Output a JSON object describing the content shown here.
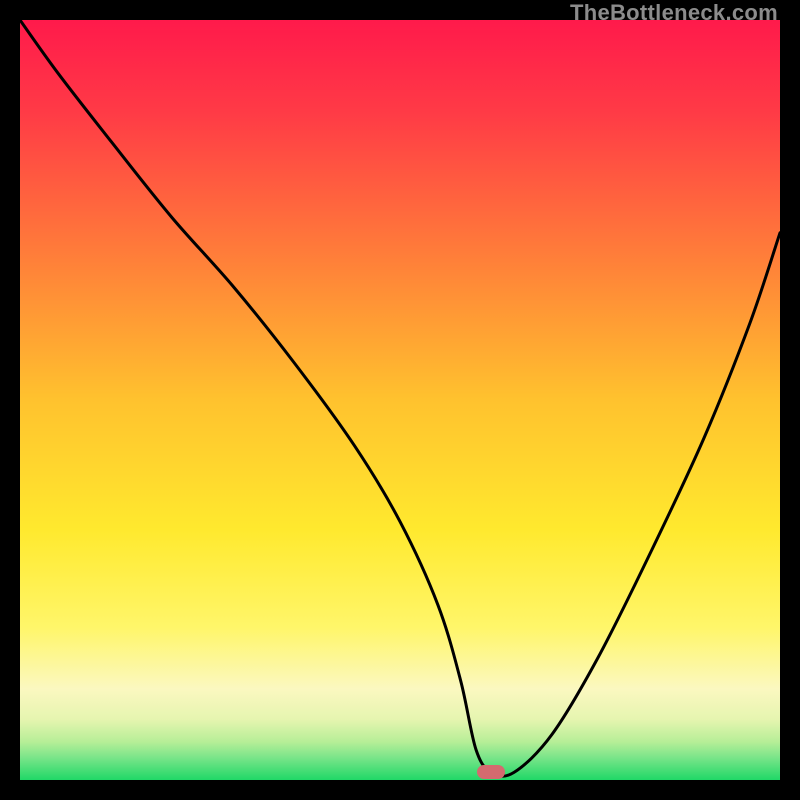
{
  "watermark": "TheBottleneck.com",
  "marker": {
    "color": "#d46a6f",
    "x_pct": 62,
    "y_pct": 99
  },
  "chart_data": {
    "type": "line",
    "title": "",
    "xlabel": "",
    "ylabel": "",
    "xlim": [
      0,
      100
    ],
    "ylim": [
      0,
      100
    ],
    "grid": false,
    "legend": false,
    "gradient_stops": [
      {
        "pct": 0,
        "color": "#ff1a4b"
      },
      {
        "pct": 12,
        "color": "#ff3a46"
      },
      {
        "pct": 30,
        "color": "#ff7a3a"
      },
      {
        "pct": 50,
        "color": "#ffc22e"
      },
      {
        "pct": 67,
        "color": "#ffe92e"
      },
      {
        "pct": 80,
        "color": "#fff66a"
      },
      {
        "pct": 88,
        "color": "#fbf8c0"
      },
      {
        "pct": 92,
        "color": "#e6f5b0"
      },
      {
        "pct": 95,
        "color": "#b6ee97"
      },
      {
        "pct": 97,
        "color": "#7be58a"
      },
      {
        "pct": 100,
        "color": "#20d867"
      }
    ],
    "series": [
      {
        "name": "bottleneck-curve",
        "x": [
          0,
          5,
          12,
          20,
          28,
          36,
          44,
          50,
          55,
          58,
          60,
          62,
          65,
          70,
          76,
          83,
          90,
          96,
          100
        ],
        "y": [
          100,
          93,
          84,
          74,
          65,
          55,
          44,
          34,
          23,
          13,
          4,
          1,
          1,
          6,
          16,
          30,
          45,
          60,
          72
        ]
      }
    ],
    "optimum": {
      "x": 62,
      "y": 0
    }
  }
}
